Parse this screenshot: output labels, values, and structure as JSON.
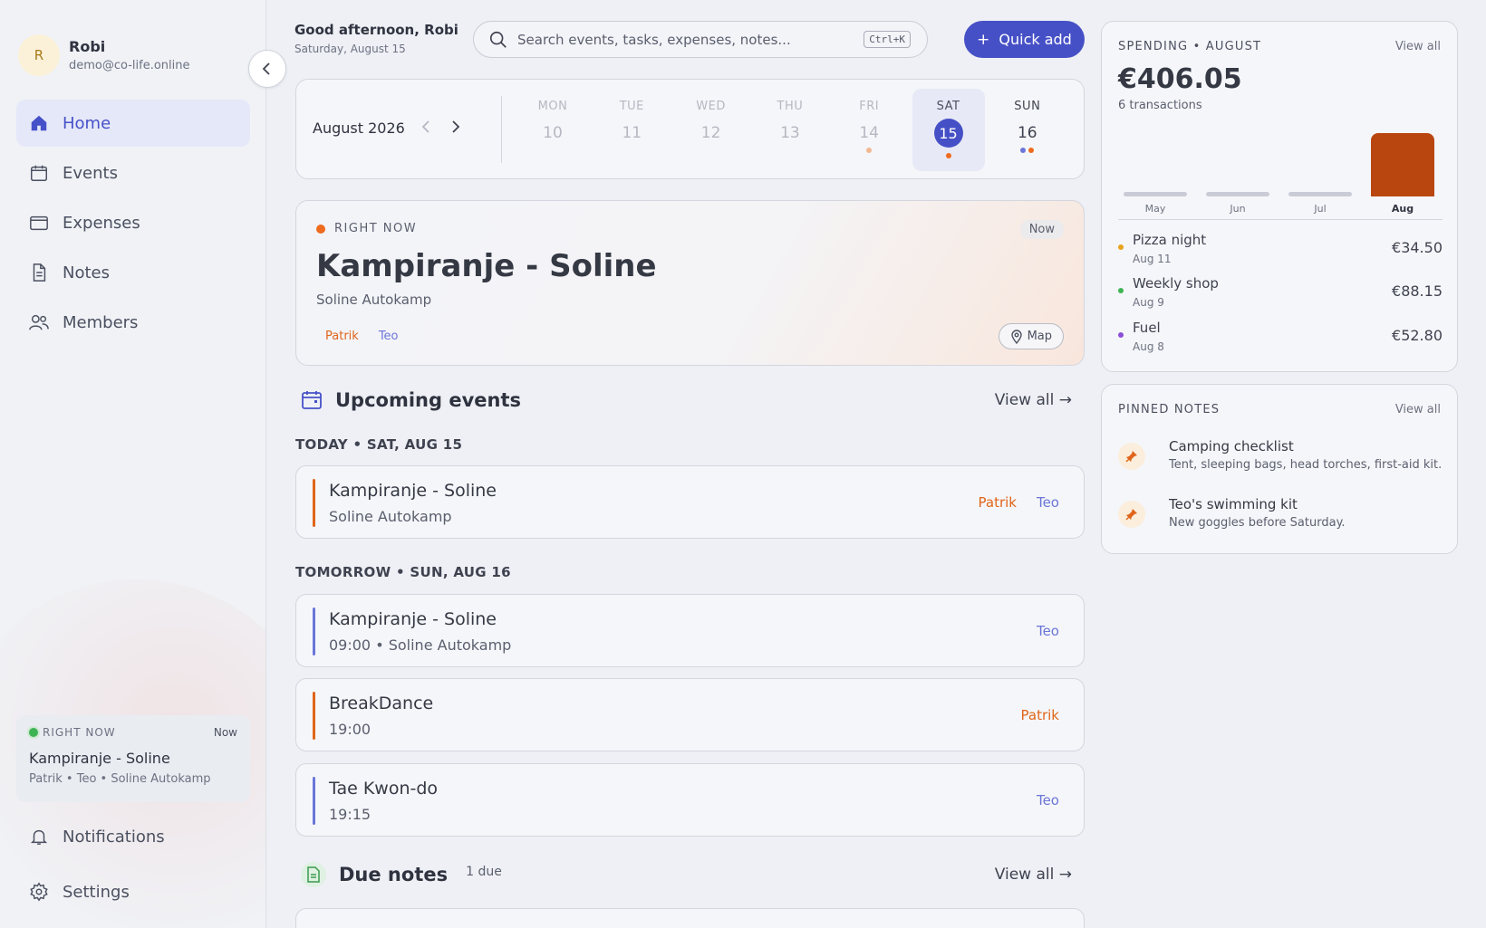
{
  "user": {
    "initial": "R",
    "name": "Robi",
    "email": "demo@co-life.online"
  },
  "nav": [
    {
      "label": "Home",
      "icon": "home-icon",
      "active": true
    },
    {
      "label": "Events",
      "icon": "calendar-icon"
    },
    {
      "label": "Expenses",
      "icon": "wallet-icon"
    },
    {
      "label": "Notes",
      "icon": "note-icon"
    },
    {
      "label": "Members",
      "icon": "members-icon"
    }
  ],
  "sidebar_now": {
    "label": "RIGHT NOW",
    "pill": "Now",
    "title": "Kampiranje - Soline",
    "sub": "Patrik • Teo • Soline Autokamp"
  },
  "bottom_nav": [
    {
      "label": "Notifications",
      "icon": "bell-icon"
    },
    {
      "label": "Settings",
      "icon": "gear-icon"
    }
  ],
  "header": {
    "greeting": "Good afternoon, Robi",
    "date": "Saturday, August 15",
    "search_placeholder": "Search events, tasks, expenses, notes...",
    "search_shortcut": "Ctrl+K",
    "quick_add": "Quick add"
  },
  "week": {
    "month": "August 2026",
    "days": [
      {
        "name": "MON",
        "num": "10",
        "state": "past"
      },
      {
        "name": "TUE",
        "num": "11",
        "state": "past"
      },
      {
        "name": "WED",
        "num": "12",
        "state": "past"
      },
      {
        "name": "THU",
        "num": "13",
        "state": "past"
      },
      {
        "name": "FRI",
        "num": "14",
        "state": "past",
        "dots": [
          "#f2b892"
        ]
      },
      {
        "name": "SAT",
        "num": "15",
        "state": "today",
        "dots": [
          "#ee6b1e"
        ]
      },
      {
        "name": "SUN",
        "num": "16",
        "state": "future",
        "dots": [
          "#6b76d9",
          "#ee6b1e"
        ]
      }
    ]
  },
  "hero": {
    "label": "RIGHT NOW",
    "pill": "Now",
    "title": "Kampiranje - Soline",
    "sub": "Soline Autokamp",
    "tag1": "Patrik",
    "tag2": "Teo",
    "map": "Map"
  },
  "upcoming": {
    "title": "Upcoming events",
    "view_all": "View all →",
    "today_label": "TODAY • SAT, AUG 15",
    "tomorrow_label": "TOMORROW • SUN, AUG 16",
    "events": [
      {
        "name": "Kampiranje - Soline",
        "meta": "Soline Autokamp",
        "people": [
          "Patrik",
          "Teo"
        ],
        "bar": "#e0651a"
      },
      {
        "name": "Kampiranje - Soline",
        "meta": "09:00 • Soline Autokamp",
        "people": [
          "Teo"
        ],
        "bar": "#6b76d9"
      },
      {
        "name": "BreakDance",
        "meta": "19:00",
        "people": [
          "Patrik"
        ],
        "bar": "#e0651a"
      },
      {
        "name": "Tae Kwon-do",
        "meta": "19:15",
        "people": [
          "Teo"
        ],
        "bar": "#6b76d9"
      }
    ]
  },
  "due_notes": {
    "title": "Due notes",
    "count": "1 due",
    "view_all": "View all →"
  },
  "spending": {
    "title": "SPENDING • AUGUST",
    "view_all": "View all",
    "amount": "€406.05",
    "transactions": "6 transactions",
    "accent": "#b9460f",
    "months": [
      {
        "label": "May",
        "value": 0
      },
      {
        "label": "Jun",
        "value": 0
      },
      {
        "label": "Jul",
        "value": 0
      },
      {
        "label": "Aug",
        "value": 406.05
      }
    ],
    "items": [
      {
        "name": "Pizza night",
        "date": "Aug 11",
        "amount": "€34.50",
        "color": "#e8a21c"
      },
      {
        "name": "Weekly shop",
        "date": "Aug 9",
        "amount": "€88.15",
        "color": "#3db454"
      },
      {
        "name": "Fuel",
        "date": "Aug 8",
        "amount": "€52.80",
        "color": "#8a4fd6"
      }
    ]
  },
  "pinned": {
    "title": "PINNED NOTES",
    "view_all": "View all",
    "notes": [
      {
        "title": "Camping checklist",
        "sub": "Tent, sleeping bags, head torches, first-aid kit."
      },
      {
        "title": "Teo's swimming kit",
        "sub": "New goggles before Saturday."
      }
    ]
  }
}
